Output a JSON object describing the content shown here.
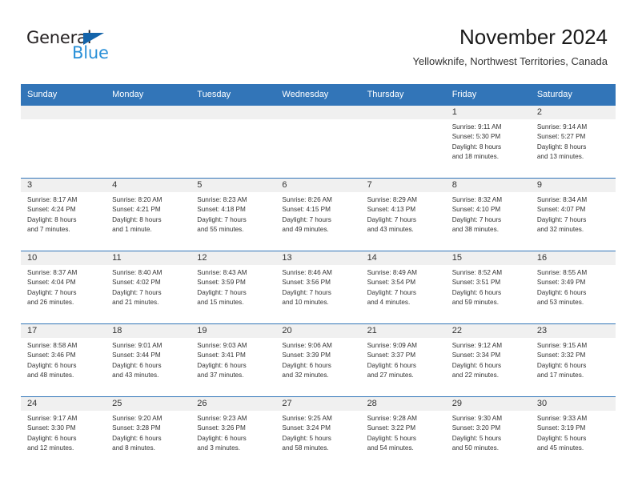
{
  "brand": {
    "name_part1": "General",
    "name_part2": "Blue",
    "triangle_icon": "triangle-icon",
    "accent_dark": "#231f20",
    "accent_blue": "#2a90d8",
    "triangle_blue": "#1464aa"
  },
  "header": {
    "title": "November 2024",
    "subtitle": "Yellowknife, Northwest Territories, Canada",
    "header_bg": "#3275b8",
    "daynum_bg": "#f0f0f0"
  },
  "weekday_headers": [
    "Sunday",
    "Monday",
    "Tuesday",
    "Wednesday",
    "Thursday",
    "Friday",
    "Saturday"
  ],
  "weeks": [
    [
      {
        "day": "",
        "sunrise": "",
        "sunset": "",
        "daylight_line1": "",
        "daylight_line2": ""
      },
      {
        "day": "",
        "sunrise": "",
        "sunset": "",
        "daylight_line1": "",
        "daylight_line2": ""
      },
      {
        "day": "",
        "sunrise": "",
        "sunset": "",
        "daylight_line1": "",
        "daylight_line2": ""
      },
      {
        "day": "",
        "sunrise": "",
        "sunset": "",
        "daylight_line1": "",
        "daylight_line2": ""
      },
      {
        "day": "",
        "sunrise": "",
        "sunset": "",
        "daylight_line1": "",
        "daylight_line2": ""
      },
      {
        "day": "1",
        "sunrise": "Sunrise: 9:11 AM",
        "sunset": "Sunset: 5:30 PM",
        "daylight_line1": "Daylight: 8 hours",
        "daylight_line2": "and 18 minutes."
      },
      {
        "day": "2",
        "sunrise": "Sunrise: 9:14 AM",
        "sunset": "Sunset: 5:27 PM",
        "daylight_line1": "Daylight: 8 hours",
        "daylight_line2": "and 13 minutes."
      }
    ],
    [
      {
        "day": "3",
        "sunrise": "Sunrise: 8:17 AM",
        "sunset": "Sunset: 4:24 PM",
        "daylight_line1": "Daylight: 8 hours",
        "daylight_line2": "and 7 minutes."
      },
      {
        "day": "4",
        "sunrise": "Sunrise: 8:20 AM",
        "sunset": "Sunset: 4:21 PM",
        "daylight_line1": "Daylight: 8 hours",
        "daylight_line2": "and 1 minute."
      },
      {
        "day": "5",
        "sunrise": "Sunrise: 8:23 AM",
        "sunset": "Sunset: 4:18 PM",
        "daylight_line1": "Daylight: 7 hours",
        "daylight_line2": "and 55 minutes."
      },
      {
        "day": "6",
        "sunrise": "Sunrise: 8:26 AM",
        "sunset": "Sunset: 4:15 PM",
        "daylight_line1": "Daylight: 7 hours",
        "daylight_line2": "and 49 minutes."
      },
      {
        "day": "7",
        "sunrise": "Sunrise: 8:29 AM",
        "sunset": "Sunset: 4:13 PM",
        "daylight_line1": "Daylight: 7 hours",
        "daylight_line2": "and 43 minutes."
      },
      {
        "day": "8",
        "sunrise": "Sunrise: 8:32 AM",
        "sunset": "Sunset: 4:10 PM",
        "daylight_line1": "Daylight: 7 hours",
        "daylight_line2": "and 38 minutes."
      },
      {
        "day": "9",
        "sunrise": "Sunrise: 8:34 AM",
        "sunset": "Sunset: 4:07 PM",
        "daylight_line1": "Daylight: 7 hours",
        "daylight_line2": "and 32 minutes."
      }
    ],
    [
      {
        "day": "10",
        "sunrise": "Sunrise: 8:37 AM",
        "sunset": "Sunset: 4:04 PM",
        "daylight_line1": "Daylight: 7 hours",
        "daylight_line2": "and 26 minutes."
      },
      {
        "day": "11",
        "sunrise": "Sunrise: 8:40 AM",
        "sunset": "Sunset: 4:02 PM",
        "daylight_line1": "Daylight: 7 hours",
        "daylight_line2": "and 21 minutes."
      },
      {
        "day": "12",
        "sunrise": "Sunrise: 8:43 AM",
        "sunset": "Sunset: 3:59 PM",
        "daylight_line1": "Daylight: 7 hours",
        "daylight_line2": "and 15 minutes."
      },
      {
        "day": "13",
        "sunrise": "Sunrise: 8:46 AM",
        "sunset": "Sunset: 3:56 PM",
        "daylight_line1": "Daylight: 7 hours",
        "daylight_line2": "and 10 minutes."
      },
      {
        "day": "14",
        "sunrise": "Sunrise: 8:49 AM",
        "sunset": "Sunset: 3:54 PM",
        "daylight_line1": "Daylight: 7 hours",
        "daylight_line2": "and 4 minutes."
      },
      {
        "day": "15",
        "sunrise": "Sunrise: 8:52 AM",
        "sunset": "Sunset: 3:51 PM",
        "daylight_line1": "Daylight: 6 hours",
        "daylight_line2": "and 59 minutes."
      },
      {
        "day": "16",
        "sunrise": "Sunrise: 8:55 AM",
        "sunset": "Sunset: 3:49 PM",
        "daylight_line1": "Daylight: 6 hours",
        "daylight_line2": "and 53 minutes."
      }
    ],
    [
      {
        "day": "17",
        "sunrise": "Sunrise: 8:58 AM",
        "sunset": "Sunset: 3:46 PM",
        "daylight_line1": "Daylight: 6 hours",
        "daylight_line2": "and 48 minutes."
      },
      {
        "day": "18",
        "sunrise": "Sunrise: 9:01 AM",
        "sunset": "Sunset: 3:44 PM",
        "daylight_line1": "Daylight: 6 hours",
        "daylight_line2": "and 43 minutes."
      },
      {
        "day": "19",
        "sunrise": "Sunrise: 9:03 AM",
        "sunset": "Sunset: 3:41 PM",
        "daylight_line1": "Daylight: 6 hours",
        "daylight_line2": "and 37 minutes."
      },
      {
        "day": "20",
        "sunrise": "Sunrise: 9:06 AM",
        "sunset": "Sunset: 3:39 PM",
        "daylight_line1": "Daylight: 6 hours",
        "daylight_line2": "and 32 minutes."
      },
      {
        "day": "21",
        "sunrise": "Sunrise: 9:09 AM",
        "sunset": "Sunset: 3:37 PM",
        "daylight_line1": "Daylight: 6 hours",
        "daylight_line2": "and 27 minutes."
      },
      {
        "day": "22",
        "sunrise": "Sunrise: 9:12 AM",
        "sunset": "Sunset: 3:34 PM",
        "daylight_line1": "Daylight: 6 hours",
        "daylight_line2": "and 22 minutes."
      },
      {
        "day": "23",
        "sunrise": "Sunrise: 9:15 AM",
        "sunset": "Sunset: 3:32 PM",
        "daylight_line1": "Daylight: 6 hours",
        "daylight_line2": "and 17 minutes."
      }
    ],
    [
      {
        "day": "24",
        "sunrise": "Sunrise: 9:17 AM",
        "sunset": "Sunset: 3:30 PM",
        "daylight_line1": "Daylight: 6 hours",
        "daylight_line2": "and 12 minutes."
      },
      {
        "day": "25",
        "sunrise": "Sunrise: 9:20 AM",
        "sunset": "Sunset: 3:28 PM",
        "daylight_line1": "Daylight: 6 hours",
        "daylight_line2": "and 8 minutes."
      },
      {
        "day": "26",
        "sunrise": "Sunrise: 9:23 AM",
        "sunset": "Sunset: 3:26 PM",
        "daylight_line1": "Daylight: 6 hours",
        "daylight_line2": "and 3 minutes."
      },
      {
        "day": "27",
        "sunrise": "Sunrise: 9:25 AM",
        "sunset": "Sunset: 3:24 PM",
        "daylight_line1": "Daylight: 5 hours",
        "daylight_line2": "and 58 minutes."
      },
      {
        "day": "28",
        "sunrise": "Sunrise: 9:28 AM",
        "sunset": "Sunset: 3:22 PM",
        "daylight_line1": "Daylight: 5 hours",
        "daylight_line2": "and 54 minutes."
      },
      {
        "day": "29",
        "sunrise": "Sunrise: 9:30 AM",
        "sunset": "Sunset: 3:20 PM",
        "daylight_line1": "Daylight: 5 hours",
        "daylight_line2": "and 50 minutes."
      },
      {
        "day": "30",
        "sunrise": "Sunrise: 9:33 AM",
        "sunset": "Sunset: 3:19 PM",
        "daylight_line1": "Daylight: 5 hours",
        "daylight_line2": "and 45 minutes."
      }
    ]
  ]
}
